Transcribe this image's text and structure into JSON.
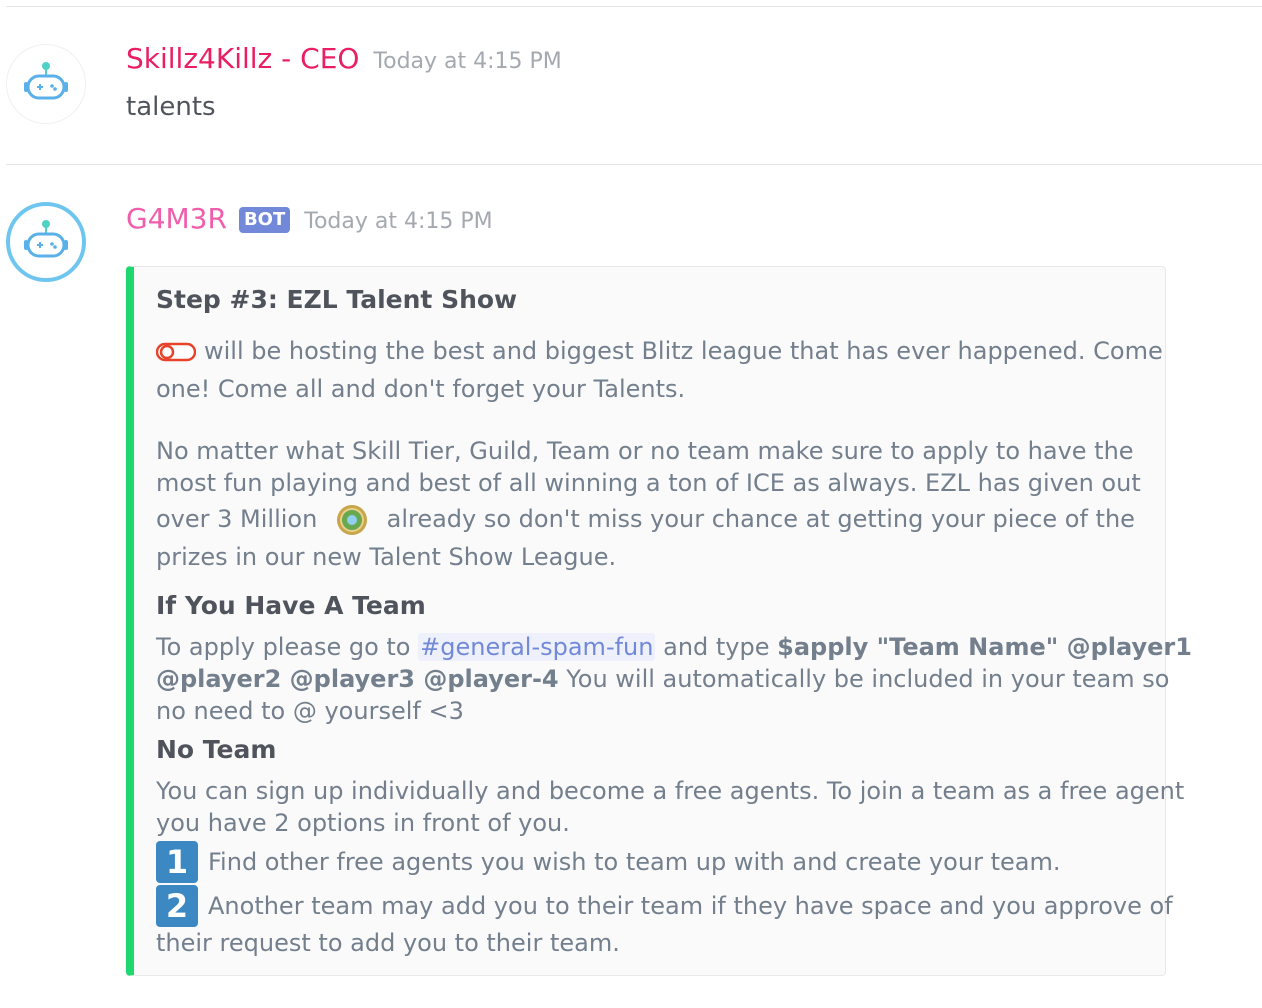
{
  "messages": [
    {
      "username": "Skillz4Killz - CEO",
      "username_color": "#e91e63",
      "timestamp": "Today at 4:15 PM",
      "text": "talents"
    },
    {
      "username": "G4M3R",
      "username_color": "#f05eab",
      "bot_tag": "BOT",
      "timestamp": "Today at 4:15 PM"
    }
  ],
  "embed": {
    "accent_color": "#1ed76f",
    "title": "Step #3: EZL Talent Show",
    "intro_line1": "will be hosting the best and biggest Blitz league that has ever happened. Come",
    "intro_line2": "one! Come all and don't forget your Talents.",
    "para2_line1": "No matter what Skill Tier, Guild, Team or no team make sure to apply to have the",
    "para2_line2": "most fun playing and best of all winning a ton of ICE as always. EZL has given out",
    "para2_line3a": "over 3 Million",
    "para2_line3b": "already so don't miss your chance at getting your piece of the",
    "para2_line4": "prizes in our new Talent Show League.",
    "field1_name": "If You Have A Team",
    "field1_pre": "To apply please go to",
    "field1_channel": "#general-spam-fun",
    "field1_mid": "and type",
    "field1_cmd1": "$apply \"Team Name\" @player1",
    "field1_cmd2": "@player2 @player3 @player-4",
    "field1_post": "You will automatically be included in your team so",
    "field1_line3": "no need to @ yourself <3",
    "field2_name": "No Team",
    "field2_line1": "You can sign up individually and become a free agents. To join a team as a free agent",
    "field2_line2": "you have 2 options in front of you.",
    "option1_num": "1",
    "option1_text": "Find other free agents you wish to team up with and create your team.",
    "option2_num": "2",
    "option2_text_line1": "Another team may add you to their team if they have space and you approve of",
    "option2_text_line2": "their request to add you to their team."
  },
  "icons": {
    "avatar": "robot-gamepad-icon",
    "toggle_emoji": "red-toggle-emoji",
    "ice_emoji": "ice-coin-emoji",
    "number_badges": "keycap-number-emoji"
  }
}
